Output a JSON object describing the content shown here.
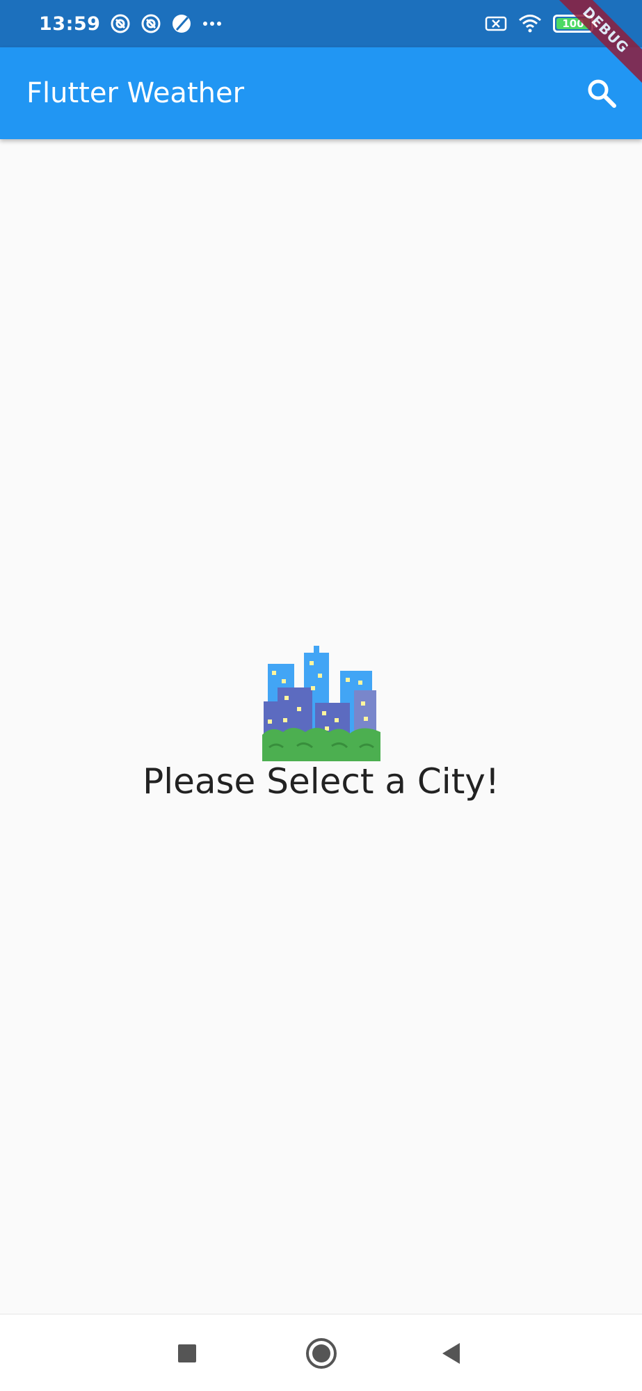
{
  "status_bar": {
    "time": "13:59",
    "battery_text": "100",
    "battery_level_percent": 100,
    "left_icons": [
      "vpn-key-icon",
      "vpn-key-icon",
      "moon-icon",
      "more-dots-icon"
    ],
    "right_icons": [
      "no-sim-icon",
      "wifi-icon",
      "battery-icon"
    ]
  },
  "debug_banner": {
    "label": "DEBUG"
  },
  "app_bar": {
    "title": "Flutter Weather",
    "background_color": "#2196f3",
    "search_icon": "search-icon"
  },
  "main": {
    "empty_state_icon": "cityscape-icon",
    "empty_state_text": "Please Select a City!"
  },
  "nav_bar": {
    "buttons": [
      "recents-icon",
      "home-icon",
      "back-icon"
    ]
  }
}
